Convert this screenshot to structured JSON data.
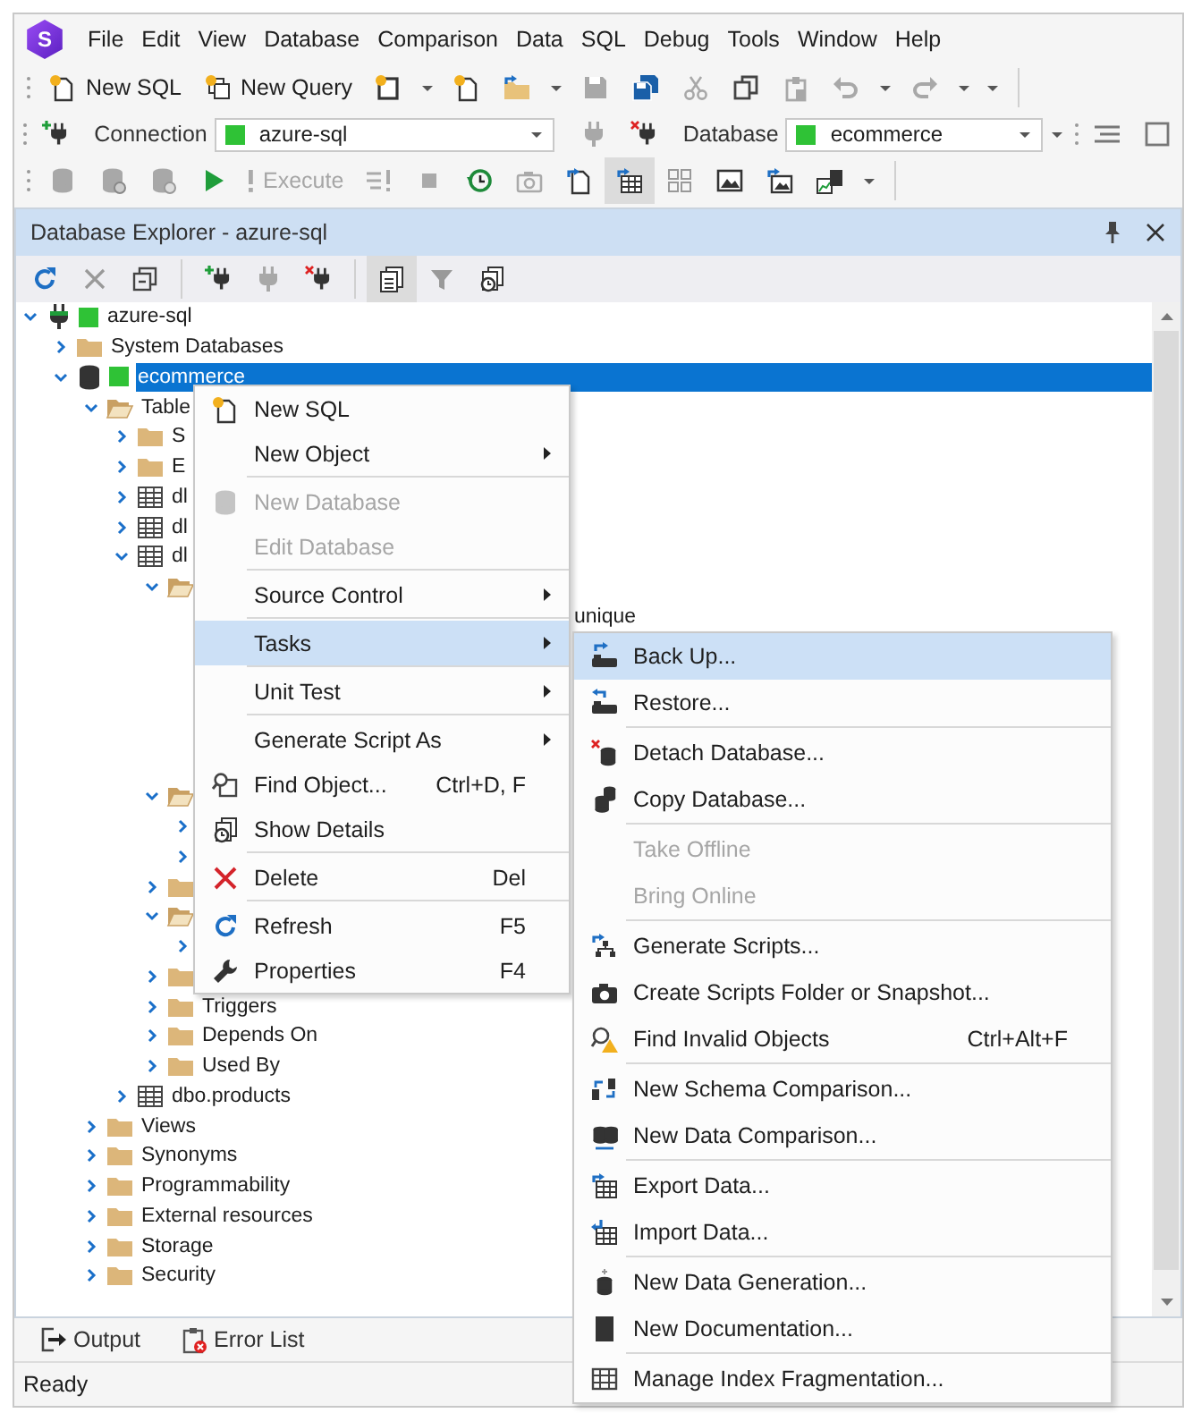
{
  "app": {
    "logo": "S",
    "menus": [
      "File",
      "Edit",
      "View",
      "Database",
      "Comparison",
      "Data",
      "SQL",
      "Debug",
      "Tools",
      "Window",
      "Help"
    ]
  },
  "toolbar": {
    "new_sql": "New SQL",
    "new_query": "New Query",
    "connection_label": "Connection",
    "connection": "azure-sql",
    "database_label": "Database",
    "database": "ecommerce",
    "execute": {
      "label": "Execute",
      "disabled": true
    },
    "grid_view_pressed": true
  },
  "explorer": {
    "title": "Database Explorer - azure-sql",
    "details_view_pressed": true,
    "tree": [
      {
        "label": "azure-sql",
        "kind": "server",
        "expanded": true,
        "selected": false,
        "children": [
          {
            "label": "System Databases",
            "kind": "folder",
            "expanded": false,
            "selected": false
          },
          {
            "label": "ecommerce",
            "kind": "database",
            "expanded": true,
            "selected": true,
            "children": [
              {
                "label": "Table",
                "kind": "folder",
                "expanded": true,
                "selected": false,
                "children": [
                  {
                    "label": "S",
                    "kind": "folder",
                    "expanded": false,
                    "selected": false
                  },
                  {
                    "label": "E",
                    "kind": "folder",
                    "expanded": false,
                    "selected": false
                  },
                  {
                    "label": "dl",
                    "kind": "table",
                    "expanded": false,
                    "selected": false
                  },
                  {
                    "label": "dl",
                    "kind": "table",
                    "expanded": false,
                    "selected": false
                  },
                  {
                    "label": "dl",
                    "kind": "table",
                    "expanded": true,
                    "selected": false,
                    "children": [
                      {
                        "kind": "folder",
                        "expanded": true,
                        "children": [
                          {
                            "label": "unique",
                            "kind": "covered",
                            "selected": false
                          }
                        ]
                      },
                      {
                        "kind": "folder",
                        "expanded": true,
                        "children": [
                          {
                            "kind": "node",
                            "expanded": false
                          },
                          {
                            "kind": "node",
                            "expanded": false
                          }
                        ]
                      },
                      {
                        "kind": "folder",
                        "expanded": false
                      },
                      {
                        "kind": "folder",
                        "expanded": true,
                        "children": [
                          {
                            "kind": "node",
                            "expanded": false
                          }
                        ]
                      },
                      {
                        "kind": "folder",
                        "expanded": false
                      },
                      {
                        "label": "Triggers",
                        "kind": "folder",
                        "expanded": false,
                        "selected": false
                      },
                      {
                        "label": "Depends On",
                        "kind": "folder",
                        "expanded": false,
                        "selected": false
                      },
                      {
                        "label": "Used By",
                        "kind": "folder",
                        "expanded": false,
                        "selected": false
                      }
                    ]
                  },
                  {
                    "label": "dbo.products",
                    "kind": "table",
                    "expanded": false,
                    "selected": false
                  }
                ]
              },
              {
                "label": "Views",
                "kind": "folder",
                "expanded": false,
                "selected": false
              },
              {
                "label": "Synonyms",
                "kind": "folder",
                "expanded": false,
                "selected": false
              },
              {
                "label": "Programmability",
                "kind": "folder",
                "expanded": false,
                "selected": false
              },
              {
                "label": "External resources",
                "kind": "folder",
                "expanded": false,
                "selected": false
              },
              {
                "label": "Storage",
                "kind": "folder",
                "expanded": false,
                "selected": false
              },
              {
                "label": "Security",
                "kind": "folder",
                "expanded": false,
                "selected": false
              }
            ]
          }
        ]
      }
    ]
  },
  "context_menu": [
    {
      "kind": "item",
      "label": "New SQL",
      "disabled": false,
      "selected": false,
      "submenu": false
    },
    {
      "kind": "item",
      "label": "New Object",
      "disabled": false,
      "selected": false,
      "submenu": true
    },
    {
      "kind": "separator"
    },
    {
      "kind": "item",
      "label": "New Database",
      "disabled": true,
      "selected": false,
      "submenu": false
    },
    {
      "kind": "item",
      "label": "Edit Database",
      "disabled": true,
      "selected": false,
      "submenu": false
    },
    {
      "kind": "separator"
    },
    {
      "kind": "item",
      "label": "Source Control",
      "disabled": false,
      "selected": false,
      "submenu": true
    },
    {
      "kind": "separator"
    },
    {
      "kind": "item",
      "label": "Tasks",
      "disabled": false,
      "selected": true,
      "submenu": true
    },
    {
      "kind": "separator"
    },
    {
      "kind": "item",
      "label": "Unit Test",
      "disabled": false,
      "selected": false,
      "submenu": true
    },
    {
      "kind": "separator"
    },
    {
      "kind": "item",
      "label": "Generate Script As",
      "disabled": false,
      "selected": false,
      "submenu": true
    },
    {
      "kind": "item",
      "label": "Find Object...",
      "shortcut": "Ctrl+D, F",
      "disabled": false,
      "selected": false,
      "submenu": false
    },
    {
      "kind": "item",
      "label": "Show Details",
      "disabled": false,
      "selected": false,
      "submenu": false
    },
    {
      "kind": "separator"
    },
    {
      "kind": "item",
      "label": "Delete",
      "shortcut": "Del",
      "disabled": false,
      "selected": false,
      "submenu": false
    },
    {
      "kind": "separator"
    },
    {
      "kind": "item",
      "label": "Refresh",
      "shortcut": "F5",
      "disabled": false,
      "selected": false,
      "submenu": false
    },
    {
      "kind": "item",
      "label": "Properties",
      "shortcut": "F4",
      "disabled": false,
      "selected": false,
      "submenu": false
    }
  ],
  "tasks_submenu": [
    {
      "kind": "item",
      "label": "Back Up...",
      "disabled": false,
      "selected": true
    },
    {
      "kind": "item",
      "label": "Restore...",
      "disabled": false,
      "selected": false
    },
    {
      "kind": "separator"
    },
    {
      "kind": "item",
      "label": "Detach Database...",
      "disabled": false,
      "selected": false
    },
    {
      "kind": "item",
      "label": "Copy Database...",
      "disabled": false,
      "selected": false
    },
    {
      "kind": "separator"
    },
    {
      "kind": "item",
      "label": "Take Offline",
      "disabled": true,
      "selected": false
    },
    {
      "kind": "item",
      "label": "Bring Online",
      "disabled": true,
      "selected": false
    },
    {
      "kind": "separator"
    },
    {
      "kind": "item",
      "label": "Generate Scripts...",
      "disabled": false,
      "selected": false
    },
    {
      "kind": "item",
      "label": "Create Scripts Folder or Snapshot...",
      "disabled": false,
      "selected": false
    },
    {
      "kind": "item",
      "label": "Find Invalid Objects",
      "shortcut": "Ctrl+Alt+F",
      "disabled": false,
      "selected": false
    },
    {
      "kind": "separator"
    },
    {
      "kind": "item",
      "label": "New Schema Comparison...",
      "disabled": false,
      "selected": false
    },
    {
      "kind": "item",
      "label": "New Data Comparison...",
      "disabled": false,
      "selected": false
    },
    {
      "kind": "separator"
    },
    {
      "kind": "item",
      "label": "Export Data...",
      "disabled": false,
      "selected": false
    },
    {
      "kind": "item",
      "label": "Import Data...",
      "disabled": false,
      "selected": false
    },
    {
      "kind": "separator"
    },
    {
      "kind": "item",
      "label": "New Data Generation...",
      "disabled": false,
      "selected": false
    },
    {
      "kind": "item",
      "label": "New Documentation...",
      "disabled": false,
      "selected": false
    },
    {
      "kind": "separator"
    },
    {
      "kind": "item",
      "label": "Manage Index Fragmentation...",
      "disabled": false,
      "selected": false
    }
  ],
  "bottom_tabs": [
    {
      "label": "Output",
      "selected": false
    },
    {
      "label": "Error List",
      "selected": false
    }
  ],
  "status_bar": "Ready"
}
